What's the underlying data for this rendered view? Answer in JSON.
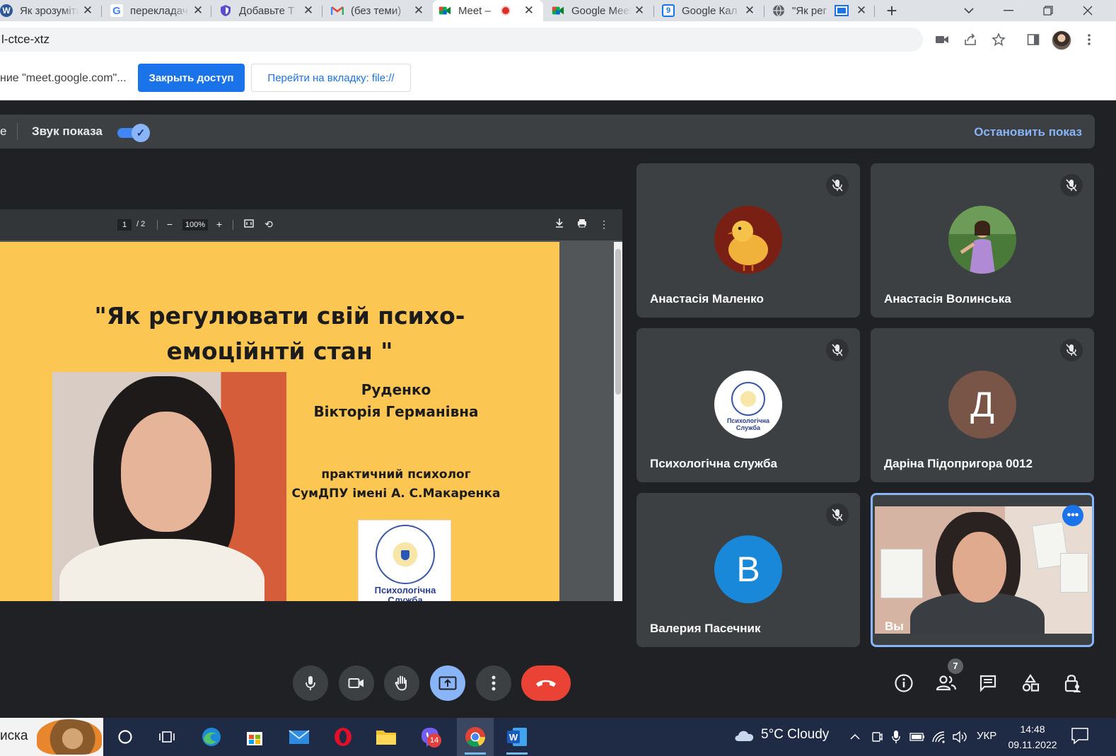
{
  "browser": {
    "tabs": [
      {
        "title": "Як зрозуміти",
        "icon": "word-icon",
        "color": "#2b579a"
      },
      {
        "title": "перекладач",
        "icon": "google-icon",
        "color": "#4285f4"
      },
      {
        "title": "Добавьте Т",
        "icon": "shield-icon",
        "color": "#5b4ccf"
      },
      {
        "title": "(без теми)",
        "icon": "gmail-icon",
        "color": "#ea4335"
      },
      {
        "title": "Meet –",
        "icon": "meet-icon",
        "color": "#00897b",
        "active": true
      },
      {
        "title": "Google Meet",
        "icon": "meet-icon",
        "color": "#00897b"
      },
      {
        "title": "Google Кал",
        "icon": "calendar-icon",
        "color": "#1a73e8"
      },
      {
        "title": "\"Як рег",
        "icon": "globe-icon",
        "color": "#5f6368"
      }
    ],
    "address_fragment": "l-ctce-xtz"
  },
  "infobar": {
    "text": "ние \"meet.google.com\"...",
    "stop_sharing_label": "Закрыть доступ",
    "switch_tab_label": "Перейти на вкладку: file://"
  },
  "presentation_bar": {
    "fragment": "е",
    "sound_label": "Звук показа",
    "sound_on": true,
    "stop_label": "Остановить показ"
  },
  "pdf": {
    "page_current": "1",
    "page_total": "/ 2",
    "zoom": "100%",
    "slide": {
      "title_line1": "\"Як регулювати свій психо-",
      "title_line2": "емоційнтй стан \"",
      "name_line1": "Руденко",
      "name_line2": "Вікторія Германівна",
      "role_line1": "практичний психолог",
      "role_line2": "СумДПУ імені А. С.Макаренка",
      "logo_text_line1": "Психологічна",
      "logo_text_line2": "Служба"
    }
  },
  "participants": [
    {
      "name": "Анастасія Маленко",
      "muted": true,
      "avatar": "chick-photo"
    },
    {
      "name": "Анастасія Волинська",
      "muted": true,
      "avatar": "person-photo"
    },
    {
      "name": "Психологічна служба",
      "muted": true,
      "avatar": "logo",
      "avatar_text1": "Психологічна",
      "avatar_text2": "Служба"
    },
    {
      "name": "Даріна Підопригора 0012",
      "muted": true,
      "avatar": "letter",
      "letter": "Д",
      "color": "#795548"
    },
    {
      "name": "Валерия Пасечник",
      "muted": true,
      "avatar": "letter",
      "letter": "В",
      "color": "#1a88d9"
    },
    {
      "name": "Вы",
      "muted": false,
      "avatar": "self-video"
    }
  ],
  "controls": {
    "participant_count": "7"
  },
  "taskbar": {
    "search_text": "иска",
    "viber_badge": "14",
    "weather": "5°C  Cloudy",
    "language": "УКР",
    "time": "14:48",
    "date": "09.11.2022"
  }
}
